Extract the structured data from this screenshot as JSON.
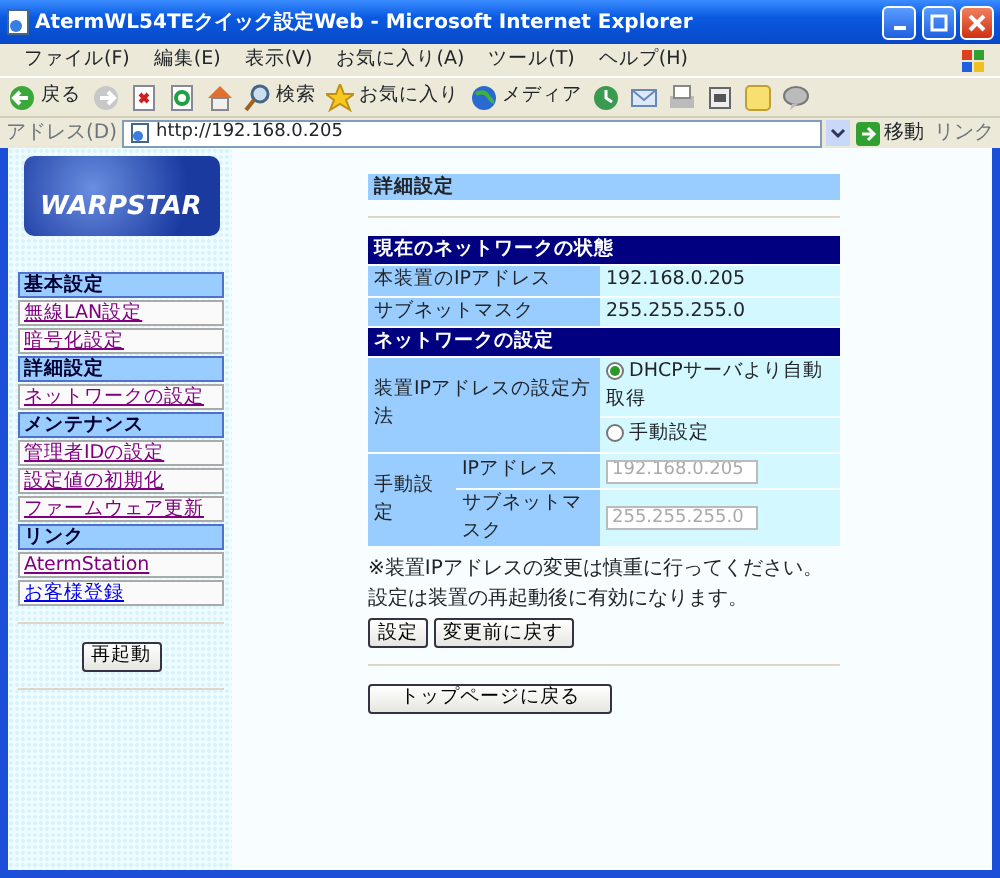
{
  "window": {
    "title": "AtermWL54TEクイック設定Web - Microsoft Internet Explorer"
  },
  "menu": [
    "ファイル(F)",
    "編集(E)",
    "表示(V)",
    "お気に入り(A)",
    "ツール(T)",
    "ヘルプ(H)"
  ],
  "toolbar": {
    "back": "戻る",
    "search": "検索",
    "favorites": "お気に入り",
    "media": "メディア"
  },
  "address": {
    "label": "アドレス(D)",
    "url": "http://192.168.0.205",
    "go": "移動",
    "links": "リンク"
  },
  "sidebar": {
    "logo": "WARPSTAR",
    "sections": [
      {
        "heading": "基本設定",
        "items": [
          {
            "label": "無線LAN設定",
            "visited": true
          },
          {
            "label": "暗号化設定",
            "visited": true
          }
        ]
      },
      {
        "heading": "詳細設定",
        "items": [
          {
            "label": "ネットワークの設定",
            "visited": true
          }
        ]
      },
      {
        "heading": "メンテナンス",
        "items": [
          {
            "label": "管理者IDの設定",
            "visited": true
          },
          {
            "label": "設定値の初期化",
            "visited": true
          },
          {
            "label": "ファームウェア更新",
            "visited": true
          }
        ]
      },
      {
        "heading": "リンク",
        "items": [
          {
            "label": "AtermStation",
            "visited": true
          },
          {
            "label": "お客様登録",
            "visited": false
          }
        ]
      }
    ],
    "restart_button": "再起動"
  },
  "main": {
    "page_title": "詳細設定",
    "status": {
      "heading": "現在のネットワークの状態",
      "rows": [
        {
          "label": "本装置のIPアドレス",
          "value": "192.168.0.205"
        },
        {
          "label": "サブネットマスク",
          "value": "255.255.255.0"
        }
      ]
    },
    "settings": {
      "heading": "ネットワークの設定",
      "method_label": "装置IPアドレスの設定方法",
      "options": [
        {
          "label": "DHCPサーバより自動取得",
          "selected": true
        },
        {
          "label": "手動設定",
          "selected": false
        }
      ],
      "manual_label": "手動設定",
      "fields": [
        {
          "label": "IPアドレス",
          "value": "192.168.0.205",
          "disabled": true
        },
        {
          "label": "サブネットマスク",
          "value": "255.255.255.0",
          "disabled": true
        }
      ]
    },
    "note": "※装置IPアドレスの変更は慎重に行ってください。設定は装置の再起動後に有効になります。",
    "buttons": [
      "設定",
      "変更前に戻す"
    ],
    "top_button": "トップページに戻る"
  }
}
